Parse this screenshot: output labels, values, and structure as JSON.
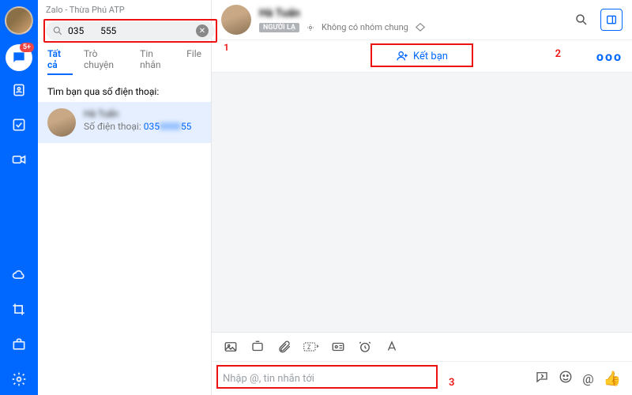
{
  "window_title": "Zalo - Thừa Phú ATP",
  "search": {
    "value": "035       555",
    "close_label": "Đóng"
  },
  "annotations": {
    "n1": "1",
    "n2": "2",
    "n3": "3"
  },
  "tabs": {
    "all": "Tất cả",
    "chats": "Trò chuyện",
    "messages": "Tin nhắn",
    "files": "File"
  },
  "results": {
    "header": "Tìm bạn qua số điện thoại:",
    "item": {
      "name": "Hà Tuấn",
      "sub_prefix": "Số điện thoại: ",
      "phone_visible_a": "035",
      "phone_visible_b": "55"
    }
  },
  "chat": {
    "name": "Hà Tuấn",
    "stranger_badge": "NGƯỜI LẠ",
    "no_common_groups": "Không có nhóm chung",
    "add_friend": "Kết bạn",
    "more": "ooo"
  },
  "composer": {
    "placeholder": "Nhập @, tin nhắn tới"
  },
  "nav": {
    "badge": "5+"
  },
  "icons": {
    "chat": "chat-icon",
    "contacts": "contacts-icon",
    "todo": "todo-icon",
    "video": "video-icon",
    "cloud": "cloud-icon",
    "crop": "crop-icon",
    "briefcase": "briefcase-icon",
    "settings": "settings-icon",
    "search": "search-icon",
    "clear": "clear-icon",
    "gear": "gear-icon",
    "tag": "tag-icon",
    "toggle": "sidebar-toggle-icon",
    "adduser": "add-user-icon",
    "image": "image-icon",
    "screenshot": "screenshot-icon",
    "attach": "attach-icon",
    "textsize": "text-size-icon",
    "namecard": "namecard-icon",
    "alarm": "alarm-icon",
    "format": "format-icon",
    "quickmsg": "quick-message-icon",
    "emoji": "emoji-icon",
    "mention": "mention-icon",
    "thumb": "thumbs-up-icon"
  }
}
